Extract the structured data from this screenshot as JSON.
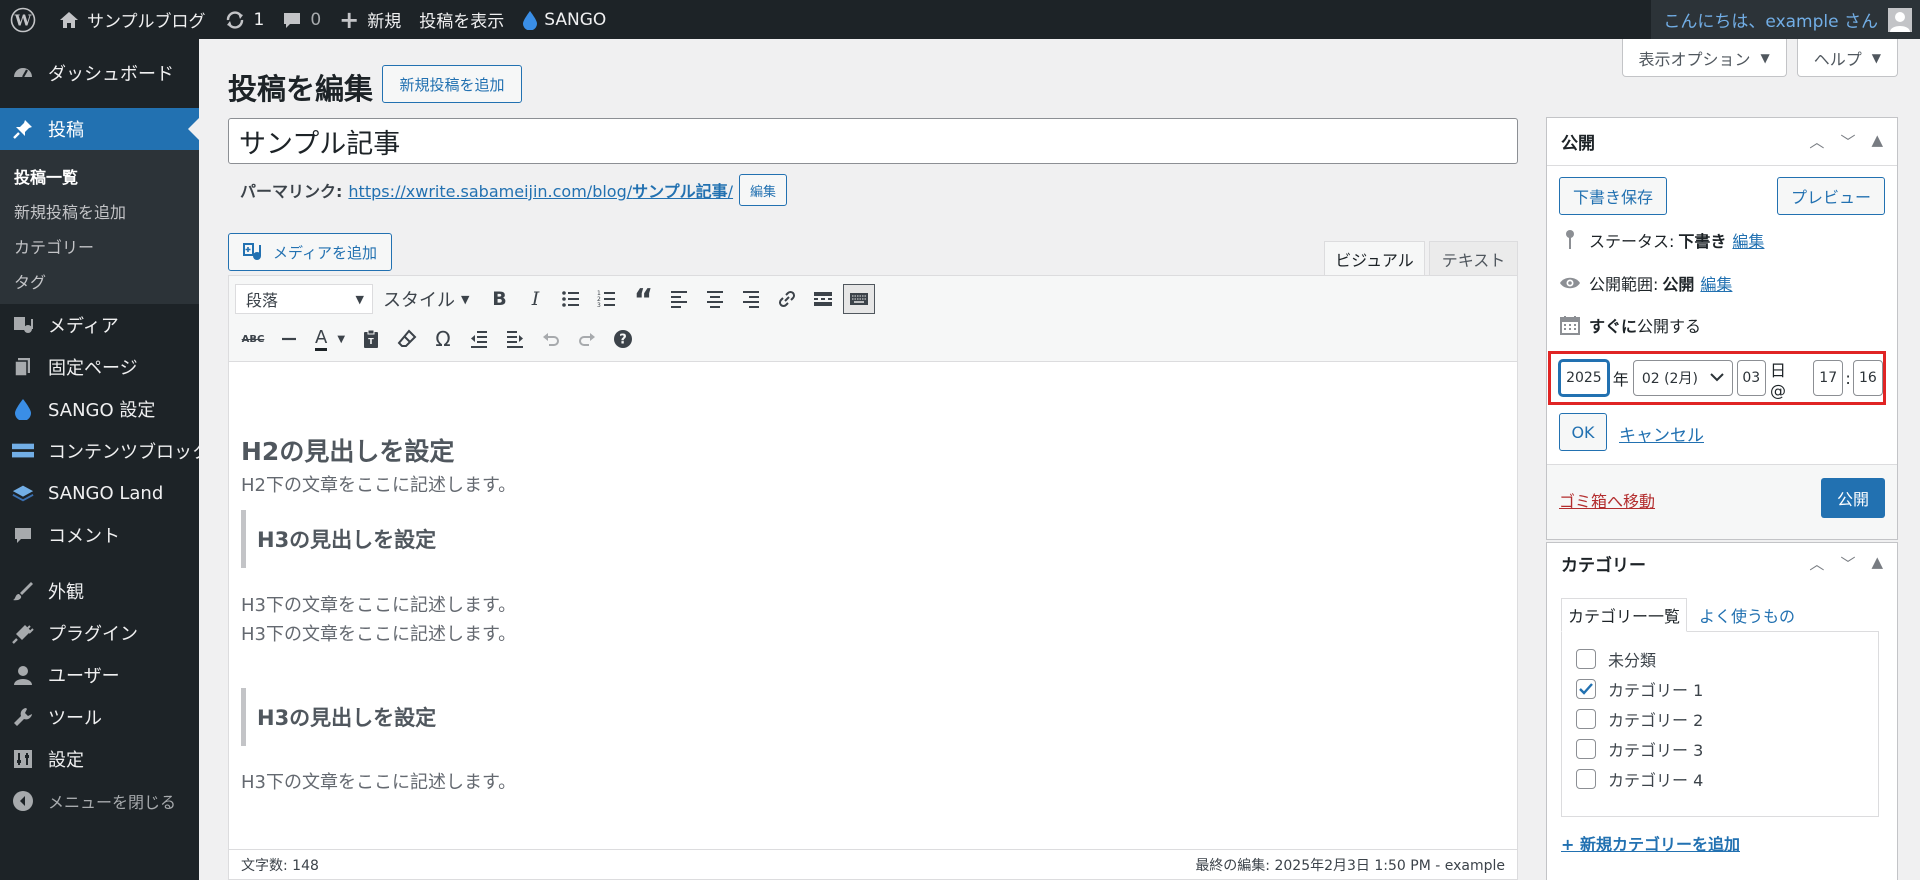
{
  "adminbar": {
    "site_name": "サンプルブログ",
    "updates_count": "1",
    "comments_count": "0",
    "new_label": "新規",
    "view_post_label": "投稿を表示",
    "sango_label": "SANGO",
    "greeting": "こんにちは、example さん"
  },
  "sidebar": {
    "dashboard": "ダッシュボード",
    "posts": "投稿",
    "sub_items": [
      "投稿一覧",
      "新規投稿を追加",
      "カテゴリー",
      "タグ"
    ],
    "media": "メディア",
    "pages": "固定ページ",
    "sango_settings": "SANGO 設定",
    "content_blocks": "コンテンツブロック",
    "sango_land": "SANGO Land",
    "comments": "コメント",
    "appearance": "外観",
    "plugins": "プラグイン",
    "users": "ユーザー",
    "tools": "ツール",
    "settings": "設定",
    "collapse": "メニューを閉じる"
  },
  "screen": {
    "options_label": "表示オプション",
    "help_label": "ヘルプ"
  },
  "page": {
    "title": "投稿を編集",
    "add_new_label": "新規投稿を追加",
    "post_title": "サンプル記事",
    "permalink_label": "パーマリンク:",
    "permalink_base": "https://xwrite.sabameijin.com/blog/",
    "permalink_slug": "サンプル記事",
    "permalink_trail": "/",
    "permalink_edit": "編集",
    "add_media_label": "メディアを追加"
  },
  "editor": {
    "tab_visual": "ビジュアル",
    "tab_text": "テキスト",
    "format_select": "段落",
    "style_select": "スタイル",
    "content": {
      "h2": "H2の見出しを設定",
      "p1": "H2下の文章をここに記述します。",
      "h3a": "H3の見出しを設定",
      "p2": "H3下の文章をここに記述します。",
      "p3": "H3下の文章をここに記述します。",
      "h3b": "H3の見出しを設定",
      "p4": "H3下の文章をここに記述します。"
    },
    "word_count": "文字数: 148",
    "last_edit": "最終の編集: 2025年2月3日 1:50 PM - example"
  },
  "publish": {
    "title": "公開",
    "save_draft": "下書き保存",
    "preview": "プレビュー",
    "status_label": "ステータス:",
    "status_value": "下書き",
    "status_edit": "編集",
    "visibility_label": "公開範囲:",
    "visibility_value": "公開",
    "visibility_edit": "編集",
    "schedule_bold": "すぐに",
    "schedule_rest": "公開する",
    "year": "2025",
    "year_suffix": "年",
    "month": "02 (2月)",
    "day": "03",
    "day_suffix": "日 @",
    "hour": "17",
    "time_sep": ":",
    "minute": "16",
    "ok": "OK",
    "cancel": "キャンセル",
    "trash": "ゴミ箱へ移動",
    "publish": "公開",
    "highlight_color": "#e02424"
  },
  "categories": {
    "title": "カテゴリー",
    "tab_all": "カテゴリー一覧",
    "tab_popular": "よく使うもの",
    "items": [
      {
        "label": "未分類",
        "checked": false
      },
      {
        "label": "カテゴリー 1",
        "checked": true
      },
      {
        "label": "カテゴリー 2",
        "checked": false
      },
      {
        "label": "カテゴリー 3",
        "checked": false
      },
      {
        "label": "カテゴリー 4",
        "checked": false
      }
    ],
    "add_new": "+ 新規カテゴリーを追加"
  },
  "colors": {
    "accent": "#2271b1",
    "admin_dark": "#1d2327"
  }
}
